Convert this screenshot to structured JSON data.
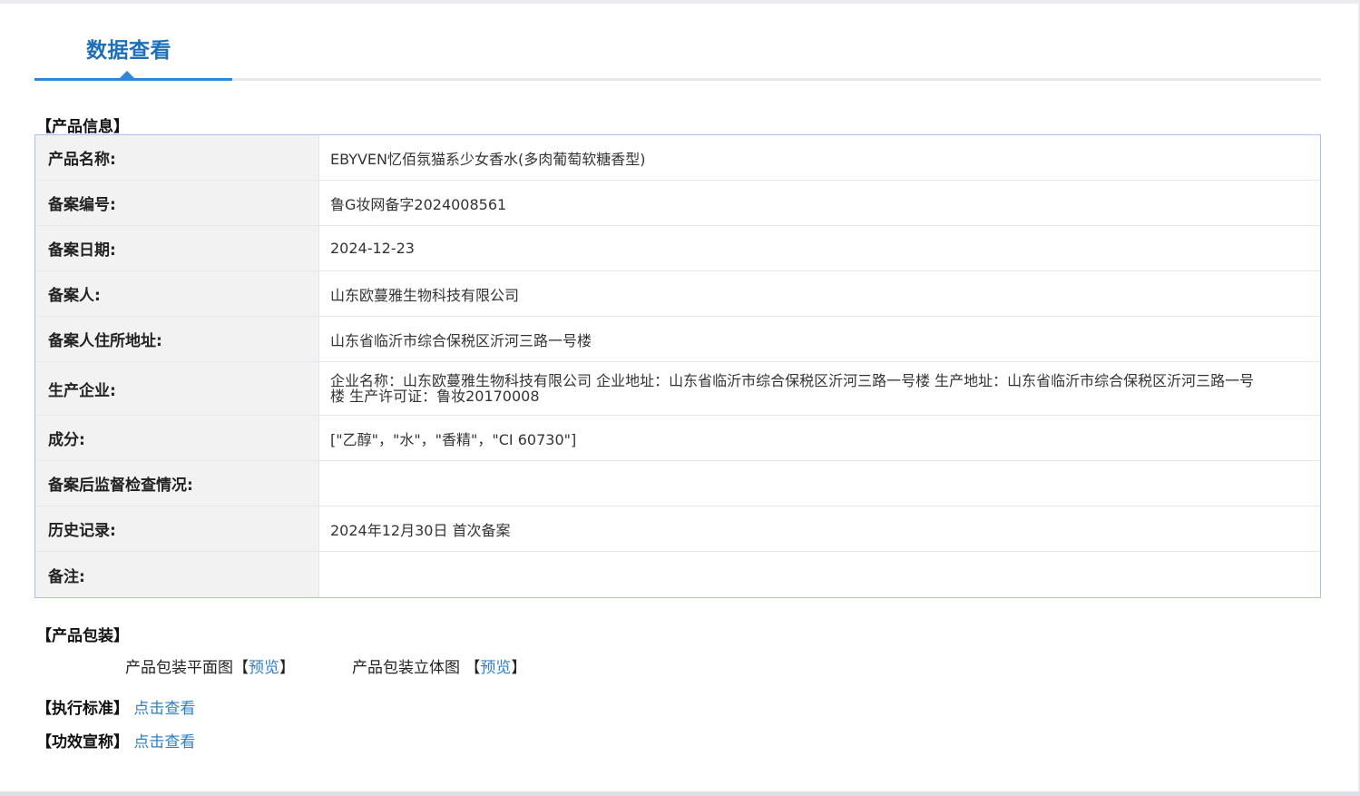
{
  "header": {
    "tab_title": "数据查看"
  },
  "product_info": {
    "heading": "【产品信息】",
    "rows": [
      {
        "label": "产品名称:",
        "value": "EBYVEN忆佰氛猫系少女香水(多肉葡萄软糖香型)"
      },
      {
        "label": "备案编号:",
        "value": "鲁G妆网备字2024008561"
      },
      {
        "label": "备案日期:",
        "value": "2024-12-23"
      },
      {
        "label": "备案人:",
        "value": "山东欧蔓雅生物科技有限公司"
      },
      {
        "label": "备案人住所地址:",
        "value": "山东省临沂市综合保税区沂河三路一号楼"
      },
      {
        "label": "生产企业:",
        "value": "企业名称：山东欧蔓雅生物科技有限公司 企业地址：山东省临沂市综合保税区沂河三路一号楼 生产地址：山东省临沂市综合保税区沂河三路一号楼 生产许可证：鲁妆20170008"
      },
      {
        "label": "成分:",
        "value": "[\"乙醇\"，\"水\"，\"香精\"，\"CI 60730\"]"
      },
      {
        "label": "备案后监督检查情况:",
        "value": ""
      },
      {
        "label": "历史记录:",
        "value": "2024年12月30日 首次备案"
      },
      {
        "label": "备注:",
        "value": ""
      }
    ]
  },
  "packaging": {
    "heading": "【产品包装】",
    "flat_label": "产品包装平面图",
    "flat_bracket_open": "【",
    "flat_link": "预览",
    "flat_bracket_close": "】",
    "stereo_label": "产品包装立体图",
    "stereo_bracket_open": " 【",
    "stereo_link": "预览",
    "stereo_bracket_close": "】"
  },
  "standard": {
    "label": "【执行标准】",
    "link": "点击查看"
  },
  "efficacy": {
    "label": "【功效宣称】",
    "link": "点击查看"
  }
}
